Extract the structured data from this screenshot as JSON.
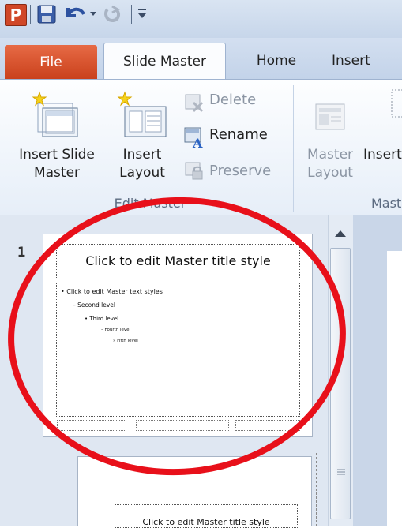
{
  "quick_access": {
    "app_letter": "P"
  },
  "tabs": {
    "file": "File",
    "slide_master": "Slide Master",
    "home": "Home",
    "insert": "Insert"
  },
  "ribbon": {
    "edit_master": {
      "insert_slide_master": "Insert Slide Master",
      "insert_layout": "Insert Layout",
      "delete": "Delete",
      "rename": "Rename",
      "preserve": "Preserve",
      "group_label": "Edit Master"
    },
    "master_layout": {
      "master_layout": "Master Layout",
      "insert_placeholder": "Insert Placeholder",
      "group_label": "Master Layout"
    }
  },
  "thumbnails": {
    "slide_number": "1",
    "master": {
      "title": "Click to edit Master title style",
      "levels": [
        "Click to edit Master text styles",
        "Second level",
        "Third level",
        "Fourth level",
        "Fifth level"
      ]
    },
    "layout": {
      "title": "Click to edit Master title style"
    }
  },
  "colors": {
    "file_tab": "#d9532b",
    "annotation": "#e8101a"
  },
  "icons": [
    "app-icon",
    "save-icon",
    "undo-icon",
    "redo-icon",
    "customize-icon",
    "delete-icon",
    "rename-icon",
    "preserve-icon",
    "insert-slide-master-icon",
    "insert-layout-icon",
    "master-layout-icon",
    "scroll-up-icon",
    "scroll-grip-icon"
  ]
}
